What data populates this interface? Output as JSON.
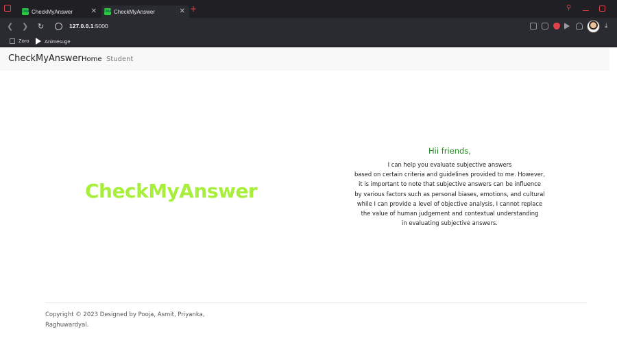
{
  "browser": {
    "tabs": [
      {
        "title": "CheckMyAnswer",
        "favicon_text": "CMA"
      },
      {
        "title": "CheckMyAnswer",
        "favicon_text": "CMA"
      }
    ],
    "new_tab_icon": "plus-icon",
    "url_host": "127.0.0.1",
    "url_port": ":5000",
    "bookmarks": [
      {
        "label": "Zoro",
        "icon": "zoro-icon"
      },
      {
        "label": "Animesuge",
        "icon": "play-icon"
      }
    ],
    "accent_color": "#e0414b"
  },
  "navbar": {
    "brand": "CheckMyAnswer",
    "links": [
      "Home",
      "Student"
    ]
  },
  "hero": {
    "title": "CheckMyAnswer",
    "title_color": "#a8ef3c"
  },
  "intro": {
    "heading": "Hii friends,",
    "heading_color": "#1d8a1d",
    "lines": [
      "I can help you evaluate subjective answers",
      "based on certain criteria and guidelines provided to me. However,",
      "it is important to note that subjective answers can be influence",
      "by various factors such as personal biases, emotions, and cultural",
      "while I can provide a level of objective analysis, I cannot replace",
      "the value of human judgement and contextual understanding",
      "in evaluating subjective answers."
    ]
  },
  "footer": {
    "line1": "Copyright © 2023 Designed by Pooja, Asmit, Priyanka,",
    "line2": "Raghuwardyal."
  }
}
